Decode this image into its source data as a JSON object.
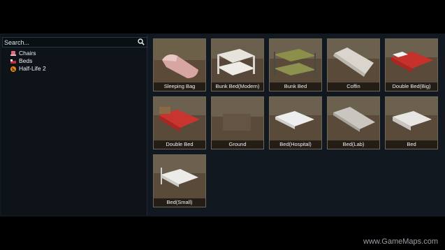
{
  "search": {
    "placeholder": "Search..."
  },
  "tree": [
    {
      "label": "Chairs",
      "icon": "chair-icon"
    },
    {
      "label": "Beds",
      "icon": "bed-icon"
    },
    {
      "label": "Half-Life 2",
      "icon": "halflife-icon"
    }
  ],
  "tiles": [
    {
      "label": "Sleeping Bag"
    },
    {
      "label": "Bunk Bed(Modern)"
    },
    {
      "label": "Bunk Bed"
    },
    {
      "label": "Coffin"
    },
    {
      "label": "Double Bed(Big)"
    },
    {
      "label": "Double Bed"
    },
    {
      "label": "Ground"
    },
    {
      "label": "Bed(Hospital)"
    },
    {
      "label": "Bed(Lab)"
    },
    {
      "label": "Bed"
    },
    {
      "label": "Bed(Small)"
    }
  ],
  "watermark": "www.GameMaps.com"
}
